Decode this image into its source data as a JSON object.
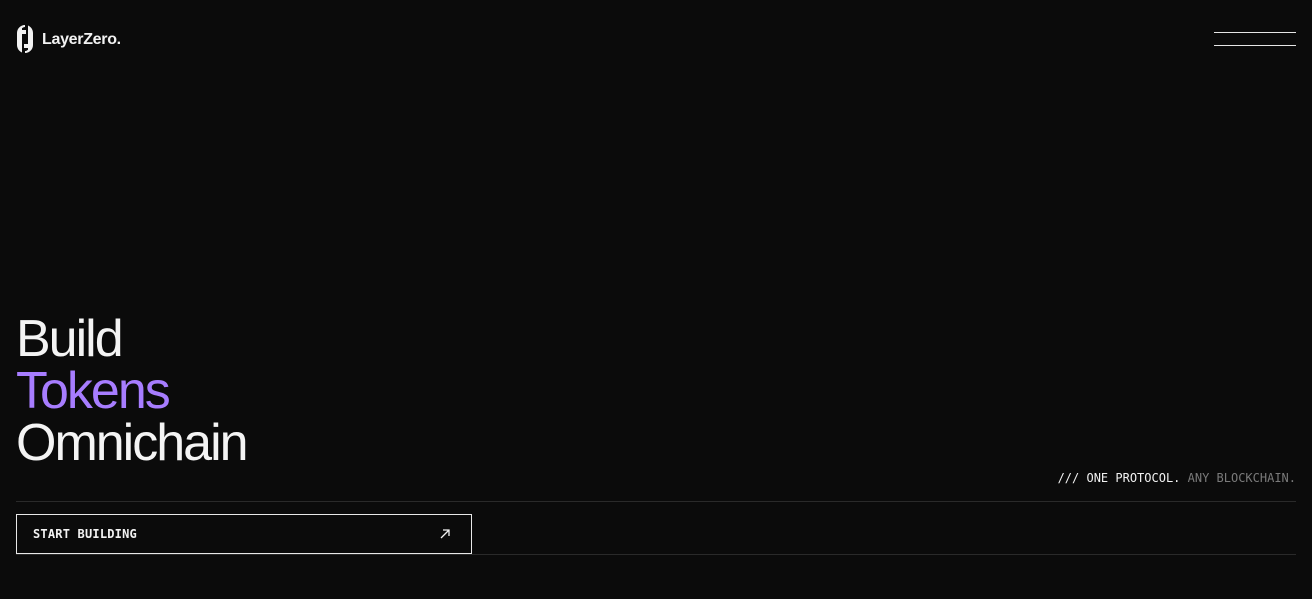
{
  "header": {
    "brand": "LayerZero.",
    "menu_icon": "hamburger-menu-icon"
  },
  "hero": {
    "line1": "Build",
    "line2": "Tokens",
    "line3": "Omnichain",
    "accent_color": "#a77dff"
  },
  "tagline": {
    "prefix": "/// ",
    "primary": "ONE PROTOCOL.",
    "secondary": "ANY BLOCKCHAIN."
  },
  "cta": {
    "label": "START BUILDING",
    "icon": "arrow-up-right-icon"
  },
  "colors": {
    "background": "#0b0b0b",
    "text": "#f2f2f2",
    "muted": "#7a7a7a"
  }
}
